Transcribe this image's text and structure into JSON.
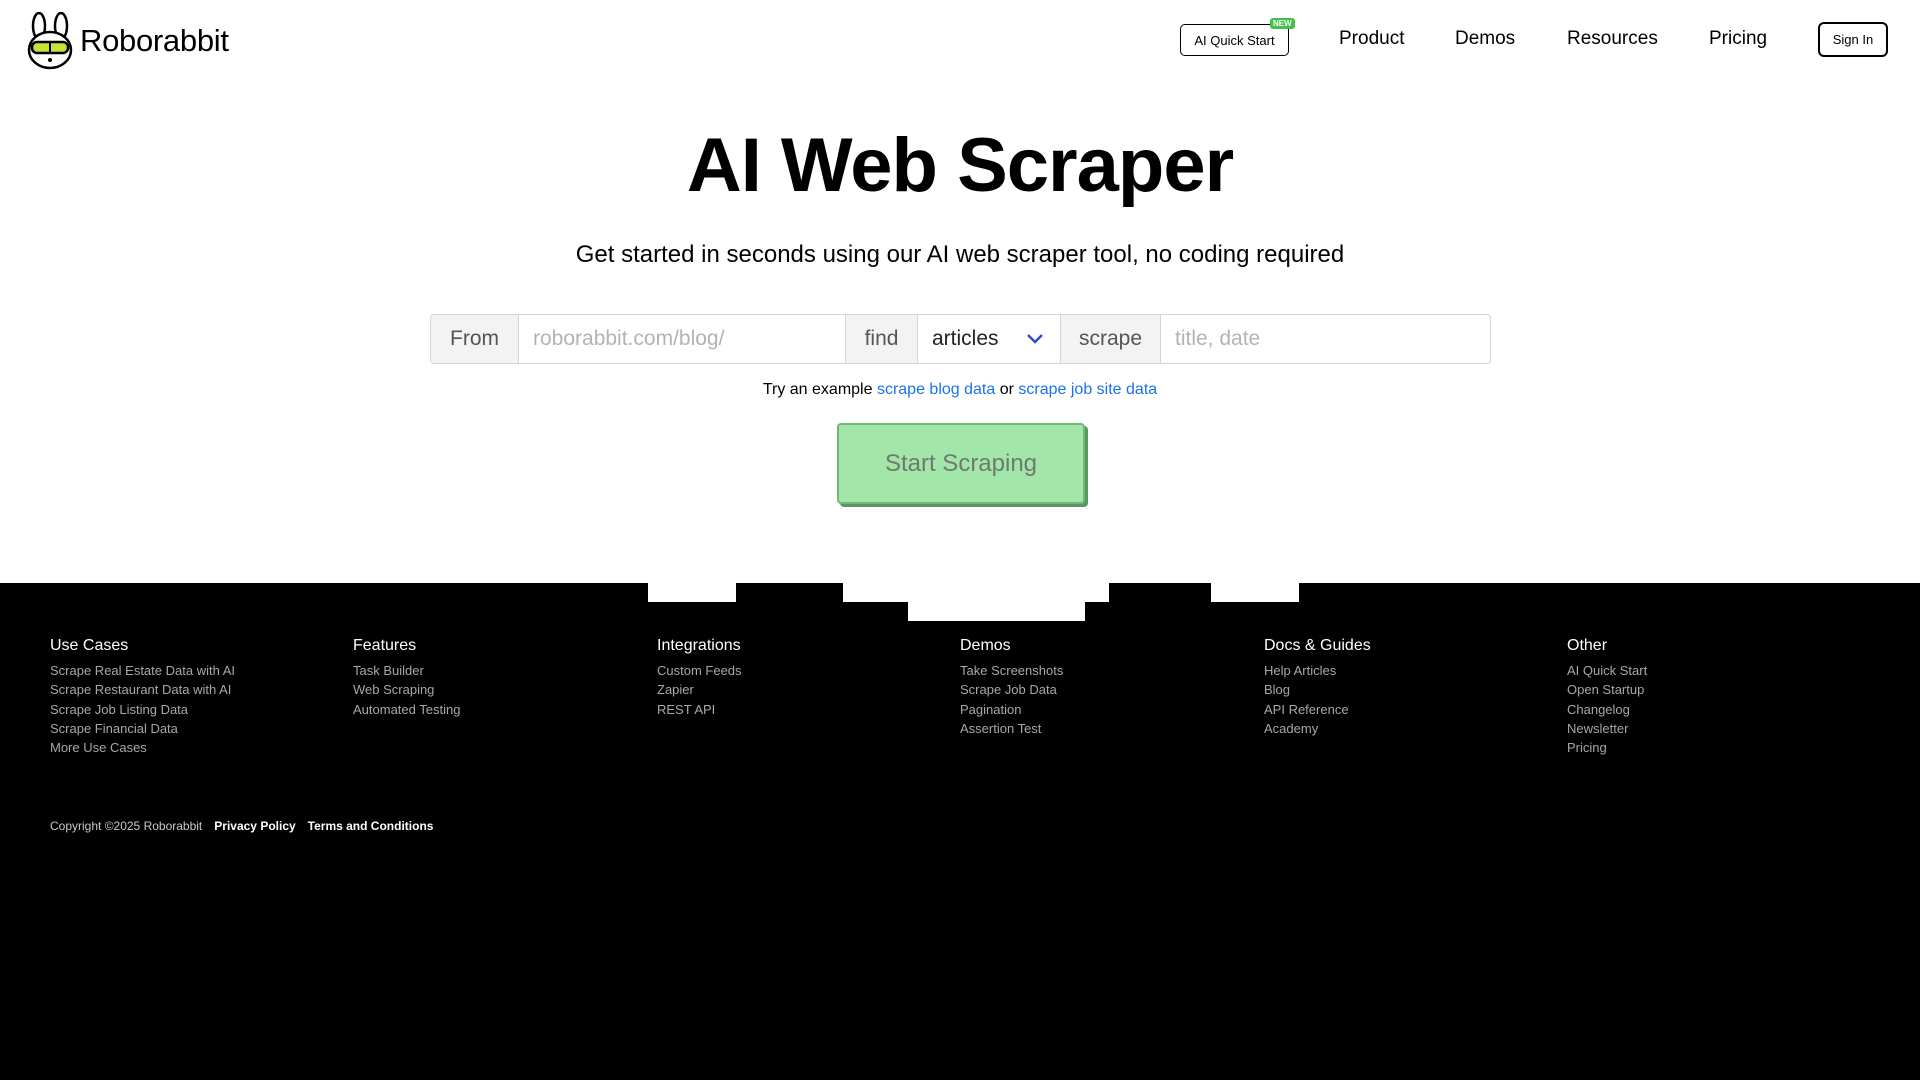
{
  "brand": {
    "name": "Roborabbit"
  },
  "header": {
    "quick_start": "AI Quick Start",
    "new_badge": "NEW",
    "nav": [
      "Product",
      "Demos",
      "Resources",
      "Pricing"
    ],
    "sign_in": "Sign In"
  },
  "hero": {
    "title": "AI Web Scraper",
    "subtitle": "Get started in seconds using our AI web scraper tool, no coding required"
  },
  "form": {
    "from_label": "From",
    "url_placeholder": "roborabbit.com/blog/",
    "find_label": "find",
    "select_value": "articles",
    "scrape_label": "scrape",
    "fields_placeholder": "title, date"
  },
  "example": {
    "prefix": "Try an example",
    "link1": "scrape blog data",
    "middle": "or",
    "link2": "scrape job site data"
  },
  "cta": {
    "label": "Start Scraping"
  },
  "footer": {
    "columns": [
      {
        "title": "Use Cases",
        "items": [
          "Scrape Real Estate Data with AI",
          "Scrape Restaurant Data with AI",
          "Scrape Job Listing Data",
          "Scrape Financial Data",
          "More Use Cases"
        ]
      },
      {
        "title": "Features",
        "items": [
          "Task Builder",
          "Web Scraping",
          "Automated Testing"
        ]
      },
      {
        "title": "Integrations",
        "items": [
          "Custom Feeds",
          "Zapier",
          "REST API"
        ]
      },
      {
        "title": "Demos",
        "items": [
          "Take Screenshots",
          "Scrape Job Data",
          "Pagination",
          "Assertion Test"
        ]
      },
      {
        "title": "Docs & Guides",
        "items": [
          "Help Articles",
          "Blog",
          "API Reference",
          "Academy"
        ]
      },
      {
        "title": "Other",
        "items": [
          "AI Quick Start",
          "Open Startup",
          "Changelog",
          "Newsletter",
          "Pricing"
        ]
      }
    ],
    "copyright": "Copyright ©2025 Roborabbit",
    "privacy": "Privacy Policy",
    "terms": "Terms and Conditions"
  },
  "colors": {
    "cta_bg": "#a2e6a9",
    "link": "#1a73e8",
    "badge": "#43c04b",
    "footer_bg": "#000000"
  },
  "icons": [
    "rabbit-logo-icon",
    "chevron-down-icon"
  ]
}
